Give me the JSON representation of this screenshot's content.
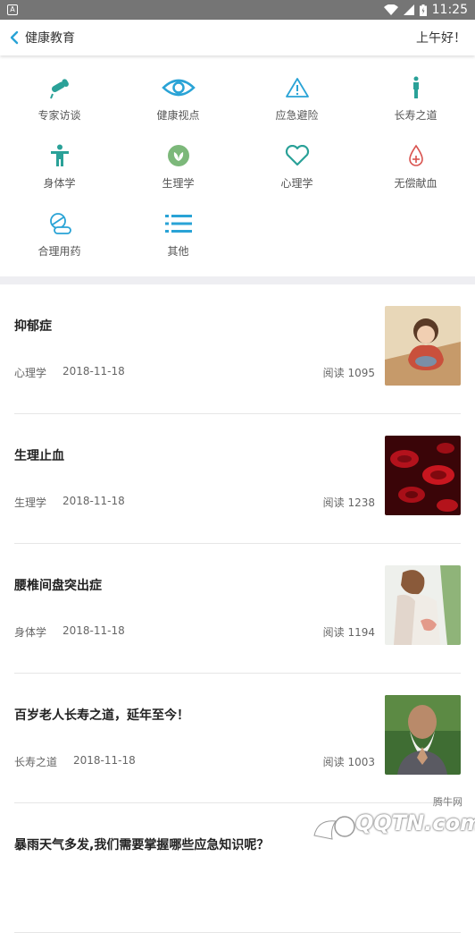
{
  "status_bar": {
    "time": "11:25",
    "notification": "A"
  },
  "app_bar": {
    "title": "健康教育",
    "greeting": "上午好！"
  },
  "categories": [
    {
      "label": "专家访谈",
      "icon": "microphone-icon"
    },
    {
      "label": "健康视点",
      "icon": "eye-icon"
    },
    {
      "label": "应急避险",
      "icon": "warning-icon"
    },
    {
      "label": "长寿之道",
      "icon": "person-standing-icon"
    },
    {
      "label": "身体学",
      "icon": "body-icon"
    },
    {
      "label": "生理学",
      "icon": "leaf-icon"
    },
    {
      "label": "心理学",
      "icon": "heart-icon"
    },
    {
      "label": "无偿献血",
      "icon": "blood-drop-icon"
    },
    {
      "label": "合理用药",
      "icon": "pills-icon"
    },
    {
      "label": "其他",
      "icon": "list-icon"
    }
  ],
  "articles": [
    {
      "title": "抑郁症",
      "category": "心理学",
      "date": "2018-11-18",
      "reads": "阅读 1095",
      "thumb": "depressed-child-illustration"
    },
    {
      "title": "生理止血",
      "category": "生理学",
      "date": "2018-11-18",
      "reads": "阅读 1238",
      "thumb": "blood-cells-image"
    },
    {
      "title": "腰椎间盘突出症",
      "category": "身体学",
      "date": "2018-11-18",
      "reads": "阅读 1194",
      "thumb": "back-pain-photo"
    },
    {
      "title": "百岁老人长寿之道，延年至今！",
      "category": "长寿之道",
      "date": "2018-11-18",
      "reads": "阅读 1003",
      "thumb": "elderly-man-photo"
    },
    {
      "title": "暴雨天气多发,我们需要掌握哪些应急知识呢？"
    }
  ],
  "watermark": {
    "text": "腾牛网",
    "logo": "QQTN.com"
  },
  "colors": {
    "accent": "#2aa198",
    "icon_blue": "#29a3d6",
    "icon_red": "#d9534f",
    "statusbar": "#757575"
  }
}
